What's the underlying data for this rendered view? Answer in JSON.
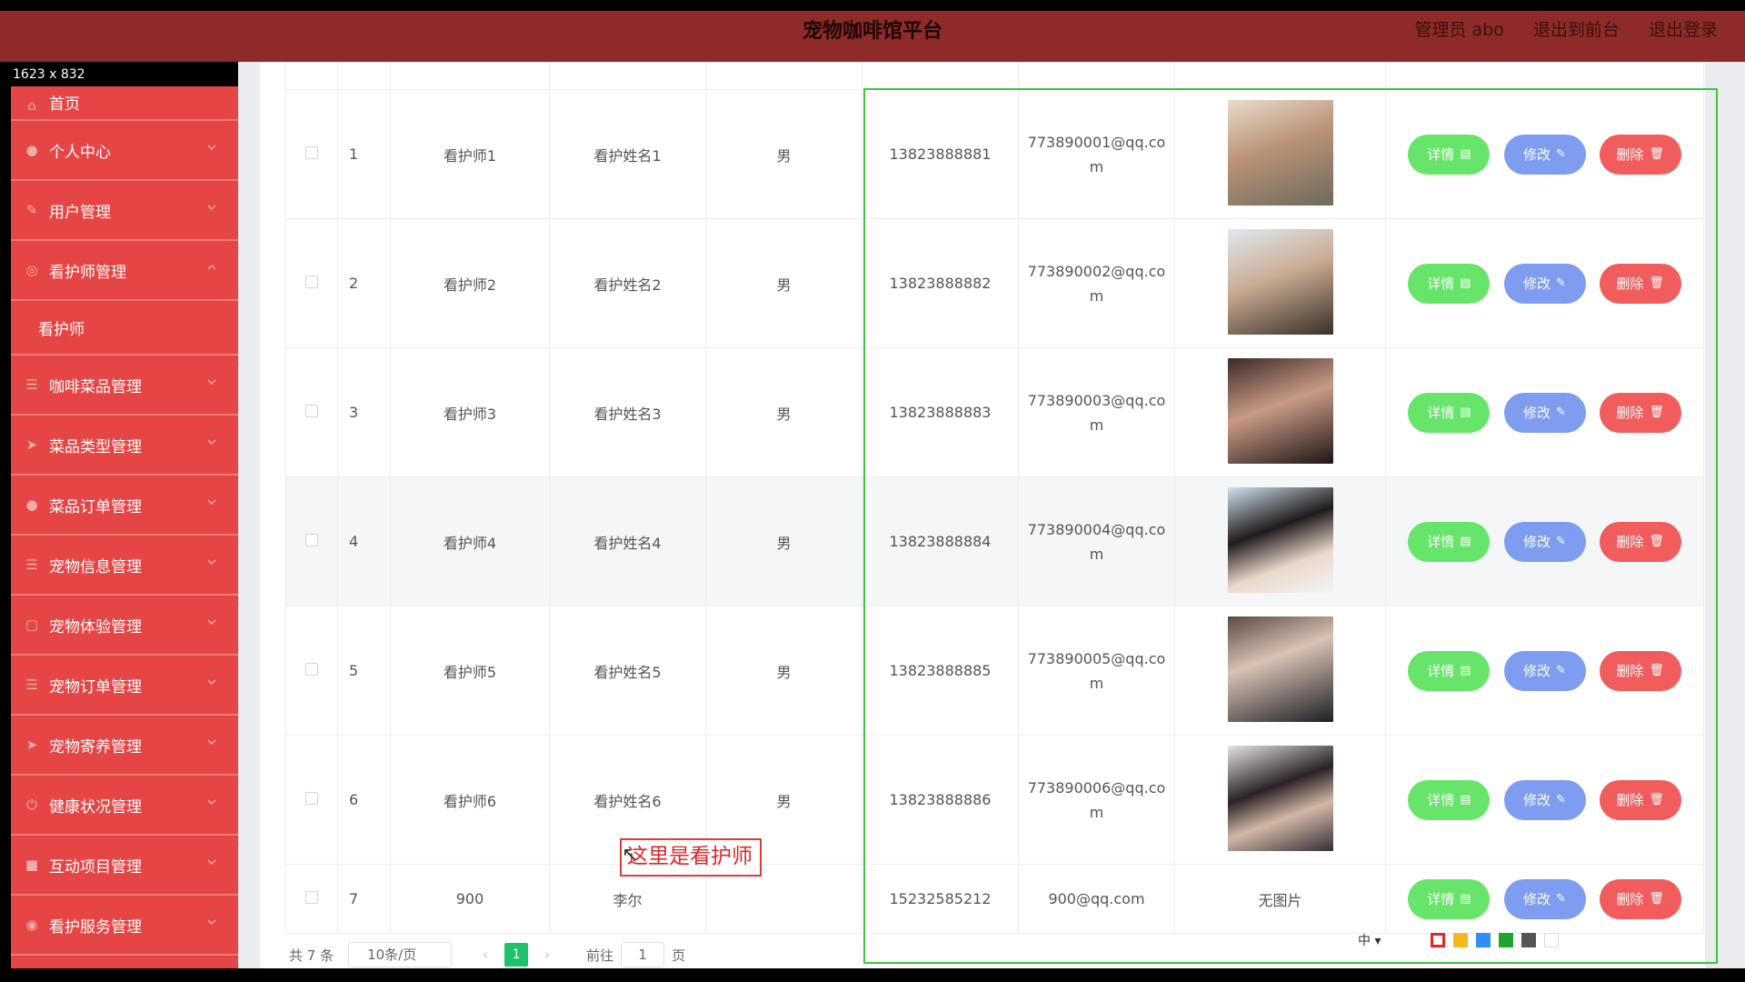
{
  "header": {
    "title": "宠物咖啡馆平台",
    "admin_label": "管理员 abo",
    "back_front": "退出到前台",
    "logout": "退出登录"
  },
  "dimension_label": "1623 x 832",
  "sidebar": {
    "items": [
      {
        "label": "首页",
        "icon": "home-icon"
      },
      {
        "label": "个人中心",
        "icon": "user-icon"
      },
      {
        "label": "用户管理",
        "icon": "user-manage-icon"
      },
      {
        "label": "看护师管理",
        "icon": "caretaker-icon"
      },
      {
        "label": "看护师",
        "icon": ""
      },
      {
        "label": "咖啡菜品管理",
        "icon": "menu-icon"
      },
      {
        "label": "菜品类型管理",
        "icon": "send-icon"
      },
      {
        "label": "菜品订单管理",
        "icon": "person-icon"
      },
      {
        "label": "宠物信息管理",
        "icon": "list-icon"
      },
      {
        "label": "宠物体验管理",
        "icon": "crop-icon"
      },
      {
        "label": "宠物订单管理",
        "icon": "list-icon"
      },
      {
        "label": "宠物寄养管理",
        "icon": "send-icon"
      },
      {
        "label": "健康状况管理",
        "icon": "power-icon"
      },
      {
        "label": "互动项目管理",
        "icon": "folder-icon"
      },
      {
        "label": "看护服务管理",
        "icon": "compass-icon"
      }
    ]
  },
  "table": {
    "rows": [
      {
        "no": "1",
        "account": "看护师1",
        "name": "看护姓名1",
        "gender": "男",
        "phone": "13823888881",
        "email1": "773890001@qq.co",
        "email2": "m",
        "photo": "portrait-1"
      },
      {
        "no": "2",
        "account": "看护师2",
        "name": "看护姓名2",
        "gender": "男",
        "phone": "13823888882",
        "email1": "773890002@qq.co",
        "email2": "m",
        "photo": "portrait-2"
      },
      {
        "no": "3",
        "account": "看护师3",
        "name": "看护姓名3",
        "gender": "男",
        "phone": "13823888883",
        "email1": "773890003@qq.co",
        "email2": "m",
        "photo": "portrait-3"
      },
      {
        "no": "4",
        "account": "看护师4",
        "name": "看护姓名4",
        "gender": "男",
        "phone": "13823888884",
        "email1": "773890004@qq.co",
        "email2": "m",
        "photo": "portrait-4"
      },
      {
        "no": "5",
        "account": "看护师5",
        "name": "看护姓名5",
        "gender": "男",
        "phone": "13823888885",
        "email1": "773890005@qq.co",
        "email2": "m",
        "photo": "portrait-5"
      },
      {
        "no": "6",
        "account": "看护师6",
        "name": "看护姓名6",
        "gender": "男",
        "phone": "13823888886",
        "email1": "773890006@qq.co",
        "email2": "m",
        "photo": "portrait-6"
      },
      {
        "no": "7",
        "account": "900",
        "name": "李尔",
        "gender": "",
        "phone": "15232585212",
        "email1": "900@qq.com",
        "email2": "",
        "photo_text": "无图片"
      }
    ],
    "btn_detail": "详情",
    "btn_edit": "修改",
    "btn_delete": "删除"
  },
  "annotation": "这里是看护师",
  "pagination": {
    "total": "共 7 条",
    "page_size": "10条/页",
    "current_page": "1",
    "goto_label": "前往",
    "goto_value": "1",
    "page_suffix": "页"
  },
  "lang": "中 ▾",
  "colors": {
    "header": "#8e2a27",
    "sidebar": "#e54545",
    "detail": "#67e56b",
    "edit": "#7f9df0",
    "delete": "#f15d5d",
    "active_page": "#1ec26a",
    "swatches": [
      "#e22828",
      "#f5b81f",
      "#2f8ef5",
      "#1fa52f",
      "#555555",
      "#ffffff"
    ]
  }
}
